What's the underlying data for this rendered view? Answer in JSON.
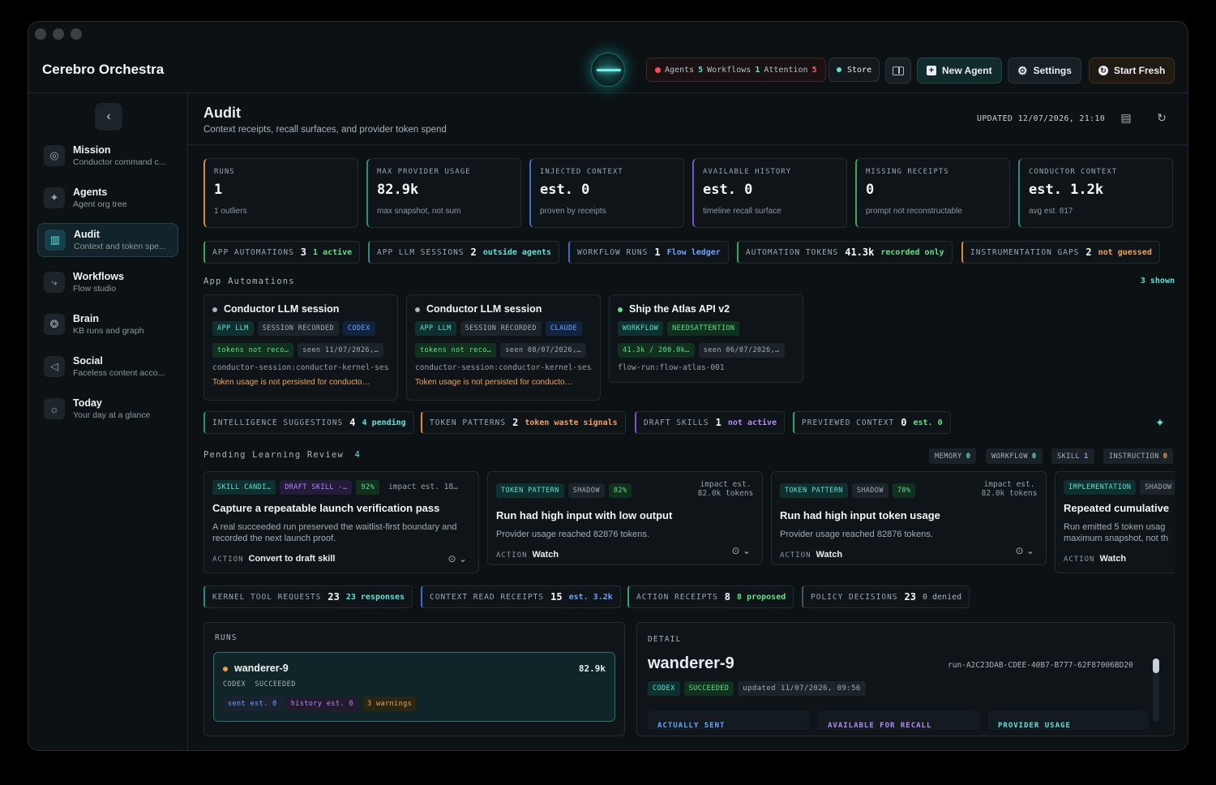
{
  "app": {
    "title": "Cerebro Orchestra"
  },
  "status": {
    "agents_label": "Agents",
    "agents": "5",
    "workflows_label": "Workflows",
    "workflows": "1",
    "attention_label": "Attention",
    "attention": "5",
    "store": "Store"
  },
  "buttons": {
    "new_agent": "New Agent",
    "settings": "Settings",
    "start_fresh": "Start Fresh"
  },
  "sidebar": {
    "items": [
      {
        "label": "Mission",
        "sub": "Conductor command c..."
      },
      {
        "label": "Agents",
        "sub": "Agent org tree"
      },
      {
        "label": "Audit",
        "sub": "Context and token spe..."
      },
      {
        "label": "Workflows",
        "sub": "Flow studio"
      },
      {
        "label": "Brain",
        "sub": "KB runs and graph"
      },
      {
        "label": "Social",
        "sub": "Faceless content acco..."
      },
      {
        "label": "Today",
        "sub": "Your day at a glance"
      }
    ]
  },
  "page": {
    "title": "Audit",
    "subtitle": "Context receipts, recall surfaces, and provider token spend",
    "updated": "UPDATED 12/07/2026, 21:10"
  },
  "stats": [
    {
      "label": "RUNS",
      "value": "1",
      "sub": "1 outliers"
    },
    {
      "label": "MAX PROVIDER USAGE",
      "value": "82.9k",
      "sub": "max snapshot, not sum"
    },
    {
      "label": "INJECTED CONTEXT",
      "value": "est. 0",
      "sub": "proven by receipts"
    },
    {
      "label": "AVAILABLE HISTORY",
      "value": "est. 0",
      "sub": "timeline recall surface"
    },
    {
      "label": "MISSING RECEIPTS",
      "value": "0",
      "sub": "prompt not reconstructable"
    },
    {
      "label": "CONDUCTOR CONTEXT",
      "value": "est. 1.2k",
      "sub": "avg est. 817"
    }
  ],
  "chips1": [
    {
      "label": "APP AUTOMATIONS",
      "num": "3",
      "extra": "1 active"
    },
    {
      "label": "APP LLM SESSIONS",
      "num": "2",
      "extra": "outside agents"
    },
    {
      "label": "WORKFLOW RUNS",
      "num": "1",
      "extra": "Flow ledger"
    },
    {
      "label": "AUTOMATION TOKENS",
      "num": "41.3k",
      "extra": "recorded only"
    },
    {
      "label": "INSTRUMENTATION GAPS",
      "num": "2",
      "extra": "not guessed"
    }
  ],
  "automations": {
    "title": "App Automations",
    "count": "3 shown",
    "cards": [
      {
        "title": "Conductor LLM session",
        "tags": [
          "APP LLM",
          "SESSION RECORDED",
          "CODEX"
        ],
        "meta1": "tokens not reco…",
        "meta2": "seen 11/07/2026,…",
        "id": "conductor-session:conductor-kernel-ses…",
        "warn": "Token usage is not persisted for conducto…"
      },
      {
        "title": "Conductor LLM session",
        "tags": [
          "APP LLM",
          "SESSION RECORDED",
          "CLAUDE"
        ],
        "meta1": "tokens not reco…",
        "meta2": "seen 08/07/2026,…",
        "id": "conductor-session:conductor-kernel-ses…",
        "warn": "Token usage is not persisted for conducto…"
      },
      {
        "title": "Ship the Atlas API v2",
        "tags": [
          "WORKFLOW",
          "NEEDSATTENTION"
        ],
        "meta1": "41.3k / 200.0k…",
        "meta2": "seen 06/07/2026,…",
        "id": "flow-run:flow-atlas-001"
      }
    ]
  },
  "chips2": [
    {
      "label": "INTELLIGENCE SUGGESTIONS",
      "num": "4",
      "extra": "4 pending"
    },
    {
      "label": "TOKEN PATTERNS",
      "num": "2",
      "extra": "token waste signals"
    },
    {
      "label": "DRAFT SKILLS",
      "num": "1",
      "extra": "not active"
    },
    {
      "label": "PREVIEWED CONTEXT",
      "num": "0",
      "extra": "est. 0"
    }
  ],
  "learning": {
    "title": "Pending Learning Review",
    "count": "4",
    "filters": [
      {
        "label": "MEMORY",
        "n": "0"
      },
      {
        "label": "WORKFLOW",
        "n": "0"
      },
      {
        "label": "SKILL",
        "n": "1"
      },
      {
        "label": "INSTRUCTION",
        "n": "0"
      }
    ],
    "cards": [
      {
        "tags": [
          "SKILL CANDI…",
          "DRAFT SKILL -…",
          "92%"
        ],
        "impact": "impact est. 18…",
        "title": "Capture a repeatable launch verification pass",
        "desc": "A real succeeded run preserved the waitlist-first boundary and recorded the next launch proof.",
        "action": "Convert to draft skill"
      },
      {
        "tags": [
          "TOKEN PATTERN",
          "SHADOW",
          "82%"
        ],
        "impact": "impact est. 82.0k tokens",
        "title": "Run had high input with low output",
        "desc": "Provider usage reached 82876 tokens.",
        "action": "Watch"
      },
      {
        "tags": [
          "TOKEN PATTERN",
          "SHADOW",
          "78%"
        ],
        "impact": "impact est. 82.0k tokens",
        "title": "Run had high input token usage",
        "desc": "Provider usage reached 82876 tokens.",
        "action": "Watch"
      },
      {
        "tags": [
          "IMPLEMENTATION",
          "SHADOW"
        ],
        "title": "Repeated cumulative",
        "desc": "Run emitted 5 token usag maximum snapshot, not th",
        "action": "Watch"
      }
    ],
    "action_label": "ACTION"
  },
  "chips3": [
    {
      "label": "KERNEL TOOL REQUESTS",
      "num": "23",
      "extra": "23 responses"
    },
    {
      "label": "CONTEXT READ RECEIPTS",
      "num": "15",
      "extra": "est. 3.2k"
    },
    {
      "label": "ACTION RECEIPTS",
      "num": "8",
      "extra": "8 proposed"
    },
    {
      "label": "POLICY DECISIONS",
      "num": "23",
      "extra": "0 denied"
    }
  ],
  "runs": {
    "title": "RUNS",
    "run": {
      "name": "wanderer-9",
      "tokens": "82.9k",
      "provider": "CODEX",
      "state": "SUCCEEDED",
      "sent": "sent est. 0",
      "history": "history est. 0",
      "warnings": "3 warnings"
    }
  },
  "detail": {
    "title": "DETAIL",
    "name": "wanderer-9",
    "run_id": "run-A2C23DAB-CDEE-40B7-B777-62F87006BD20",
    "tags": [
      "CODEX",
      "SUCCEEDED",
      "updated 11/07/2026, 09:56"
    ],
    "cols": [
      "ACTUALLY SENT",
      "AVAILABLE FOR RECALL",
      "PROVIDER USAGE"
    ]
  },
  "colors": {
    "accent": "#5fe3d6",
    "warning": "#f0a35a",
    "danger": "#ff4d5a"
  }
}
